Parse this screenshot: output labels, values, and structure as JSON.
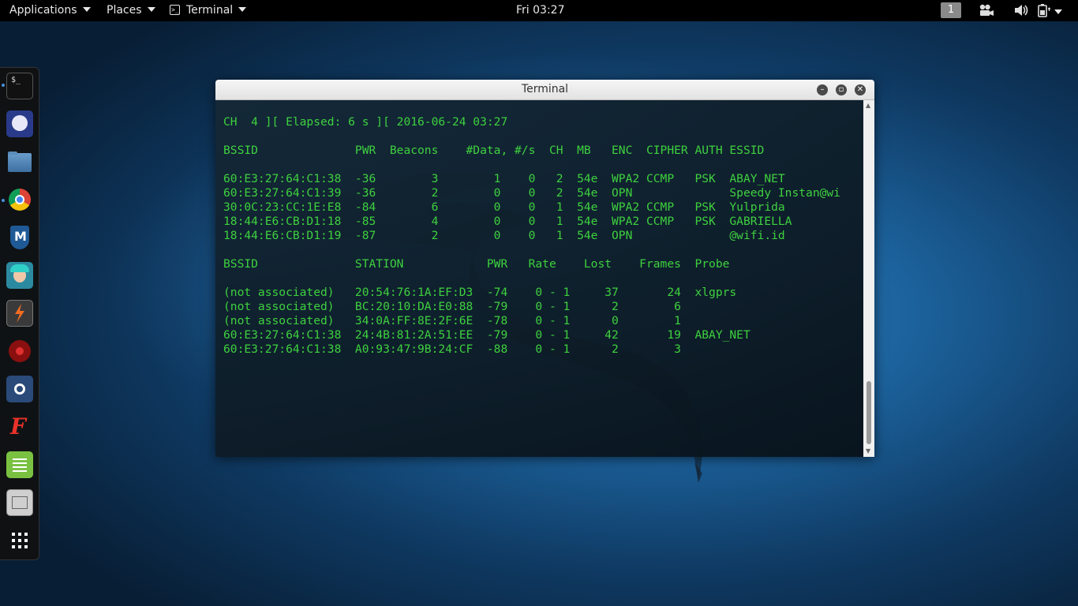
{
  "topbar": {
    "applications": "Applications",
    "places": "Places",
    "terminal": "Terminal",
    "clock": "Fri 03:27",
    "workspace": "1"
  },
  "window": {
    "title": "Terminal"
  },
  "terminal": {
    "header": "CH  4 ][ Elapsed: 6 s ][ 2016-06-24 03:27",
    "ap_header": "BSSID              PWR  Beacons    #Data, #/s  CH  MB   ENC  CIPHER AUTH ESSID",
    "ap_rows": [
      "60:E3:27:64:C1:38  -36        3        1    0   2  54e  WPA2 CCMP   PSK  ABAY_NET",
      "60:E3:27:64:C1:39  -36        2        0    0   2  54e  OPN              Speedy Instan@wi",
      "30:0C:23:CC:1E:E8  -84        6        0    0   1  54e  WPA2 CCMP   PSK  Yulprida",
      "18:44:E6:CB:D1:18  -85        4        0    0   1  54e  WPA2 CCMP   PSK  GABRIELLA",
      "18:44:E6:CB:D1:19  -87        2        0    0   1  54e  OPN              @wifi.id"
    ],
    "station_header": "BSSID              STATION            PWR   Rate    Lost    Frames  Probe",
    "station_rows": [
      "(not associated)   20:54:76:1A:EF:D3  -74    0 - 1     37       24  xlgprs",
      "(not associated)   BC:20:10:DA:E0:88  -79    0 - 1      2        6",
      "(not associated)   34:0A:FF:8E:2F:6E  -78    0 - 1      0        1",
      "60:E3:27:64:C1:38  24:4B:81:2A:51:EE  -79    0 - 1     42       19  ABAY_NET",
      "60:E3:27:64:C1:38  A0:93:47:9B:24:CF  -88    0 - 1      2        3"
    ]
  },
  "icons": {
    "dock": [
      "terminal-icon",
      "app-icon",
      "files-icon",
      "chrome-icon",
      "metasploit-icon",
      "armitage-icon",
      "burpsuite-icon",
      "faraday-icon",
      "maltego-icon",
      "fern-icon",
      "text-editor-icon",
      "settings-icon",
      "show-apps-icon"
    ],
    "tray": [
      "camera-icon",
      "volume-icon",
      "battery-icon",
      "power-icon"
    ]
  },
  "colors": {
    "terminal_text": "#3ed13e",
    "topbar_bg": "#000000",
    "accent": "#4a90d9"
  }
}
